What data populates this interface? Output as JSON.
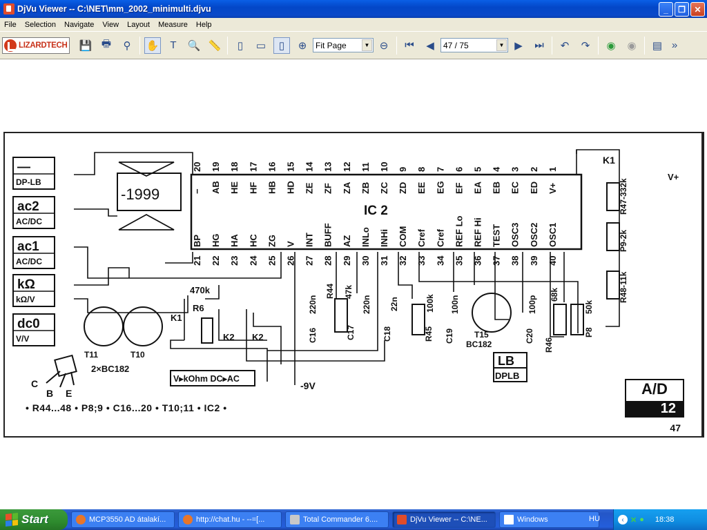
{
  "window": {
    "title": "DjVu Viewer -- C:\\NET\\mm_2002_minimulti.djvu",
    "minimize": "_",
    "maximize": "❐",
    "close": "✕"
  },
  "menu": [
    "File",
    "Selection",
    "Navigate",
    "View",
    "Layout",
    "Measure",
    "Help"
  ],
  "toolbar": {
    "logo": "LIZARDTECH",
    "zoom_value": "Fit Page",
    "page_value": "47 / 75"
  },
  "schematic": {
    "ic_label": "IC 2",
    "display": "-1999",
    "pins_top": [
      "20",
      "19",
      "18",
      "17",
      "16",
      "15",
      "14",
      "13",
      "12",
      "11",
      "10",
      "9",
      "8",
      "7",
      "6",
      "5",
      "4",
      "3",
      "2",
      "1"
    ],
    "pin_names_top": [
      "−",
      "AB",
      "HE",
      "HF",
      "HB",
      "HD",
      "ZE",
      "ZF",
      "ZA",
      "ZB",
      "ZC",
      "ZD",
      "EE",
      "EG",
      "EF",
      "EA",
      "EB",
      "EC",
      "ED",
      "V+"
    ],
    "pins_bottom": [
      "21",
      "22",
      "23",
      "24",
      "25",
      "26",
      "27",
      "28",
      "29",
      "30",
      "31",
      "32",
      "33",
      "34",
      "35",
      "36",
      "37",
      "38",
      "39",
      "40"
    ],
    "pin_names_bottom": [
      "BP",
      "HG",
      "HA",
      "HC",
      "ZG",
      "V",
      "INT",
      "BUFF",
      "AZ",
      "INLo",
      "INHi",
      "COM",
      "Cref",
      "Cref",
      "REF Lo",
      "REF Hi",
      "TEST",
      "OSC3",
      "OSC2",
      "OSC1"
    ],
    "left_boxes": [
      {
        "top": "—",
        "bottom": "DP-LB"
      },
      {
        "top": "ac2",
        "bottom": "AC/DC"
      },
      {
        "top": "ac1",
        "bottom": "AC/DC"
      },
      {
        "top": "kΩ",
        "bottom": "kΩ/V"
      },
      {
        "top": "dc0",
        "bottom": "V/V"
      }
    ],
    "labels": {
      "k1_top": "K1",
      "vplus": "V+",
      "r47": "R47-332k",
      "p9": "P9-2k",
      "r48": "R48-11k",
      "r6": "R6",
      "r6_val": "470k",
      "k1": "K1",
      "k2a": "K2",
      "k2b": "K2",
      "t11": "T11",
      "t10": "T10",
      "transistors": "2×BC182",
      "c_pin": "C",
      "b_pin": "B",
      "e_pin": "E",
      "mode": "V▸kOhm DC▸AC",
      "neg9v": "-9V",
      "c16": "C16",
      "c16v": "220n",
      "r44": "R44",
      "r44v": "47k",
      "c17": "C17",
      "c17v": "220n",
      "c18": "C18",
      "c18v": "22n",
      "r45": "R45",
      "r45v": "100k",
      "c19": "C19",
      "c19v": "100n",
      "t15": "T15",
      "t15v": "BC182",
      "c20": "C20",
      "c20v": "100p",
      "r46": "R46",
      "r46v": "68k",
      "p8": "P8",
      "p8v": "50k",
      "lb_top": "LB",
      "lb_bottom": "DPLB"
    },
    "caption": "• R44...48 • P8;9 • C16...20 • T10;11 • IC2 •",
    "ad_top": "A/D",
    "ad_num": "12",
    "page_number": "47"
  },
  "taskbar": {
    "start": "Start",
    "tasks": [
      "MCP3550 AD átalakí...",
      "http://chat.hu - --=[...",
      "Total Commander 6....",
      "DjVu Viewer -- C:\\NE...",
      "Windows"
    ],
    "lang": "HU",
    "clock": "18:38"
  }
}
